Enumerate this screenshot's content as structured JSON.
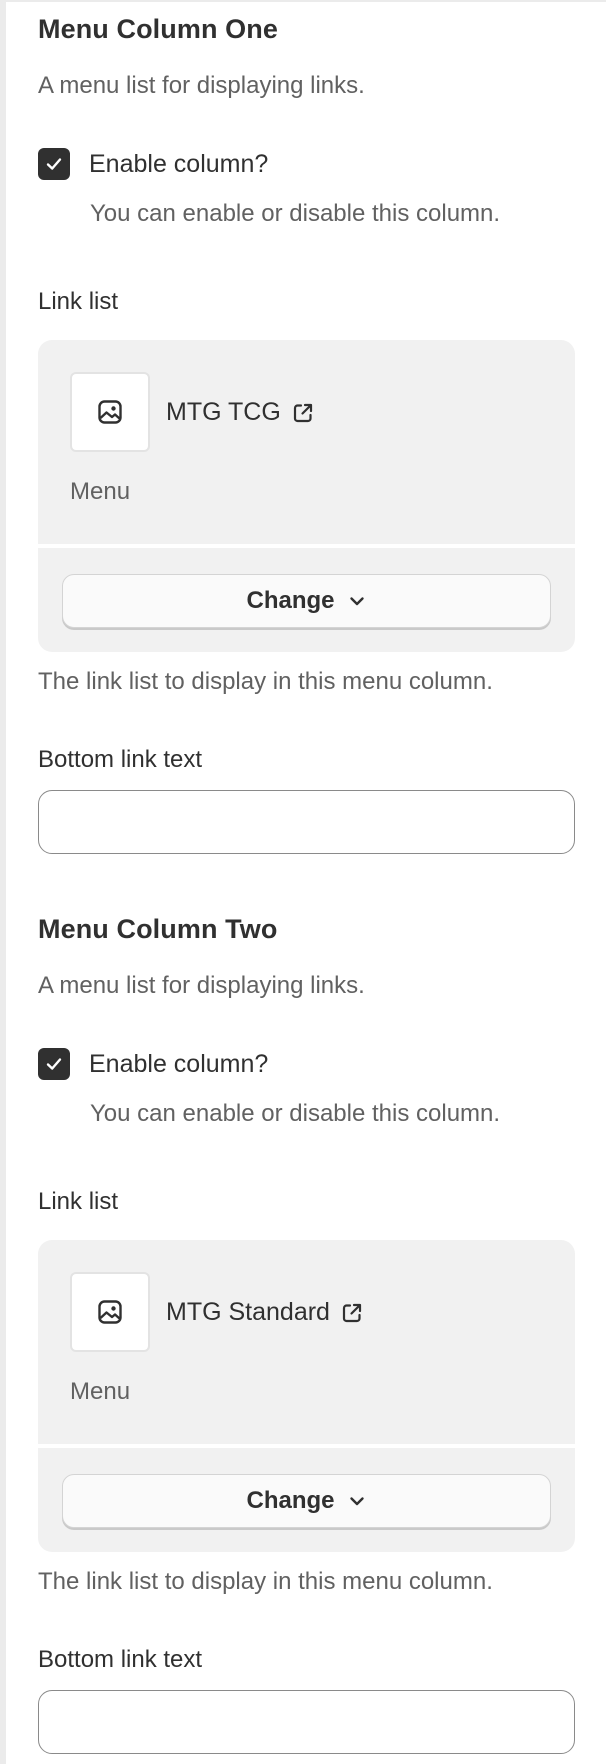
{
  "sections": [
    {
      "title": "Menu Column One",
      "description": "A menu list for displaying links.",
      "enable_label": "Enable column?",
      "enable_help": "You can enable or disable this column.",
      "enabled": true,
      "link_list_label": "Link list",
      "link": {
        "title": "MTG TCG",
        "type": "Menu"
      },
      "change_label": "Change",
      "link_list_help": "The link list to display in this menu column.",
      "bottom_label": "Bottom link text",
      "bottom_value": ""
    },
    {
      "title": "Menu Column Two",
      "description": "A menu list for displaying links.",
      "enable_label": "Enable column?",
      "enable_help": "You can enable or disable this column.",
      "enabled": true,
      "link_list_label": "Link list",
      "link": {
        "title": "MTG Standard",
        "type": "Menu"
      },
      "change_label": "Change",
      "link_list_help": "The link list to display in this menu column.",
      "bottom_label": "Bottom link text",
      "bottom_value": ""
    }
  ],
  "icons": {
    "checkbox": "check-icon",
    "thumbnail": "image-icon",
    "external": "external-link-icon",
    "dropdown": "chevron-down-icon"
  },
  "colors": {
    "text": "#303030",
    "muted": "#616161",
    "card_bg": "#f1f1f1",
    "checkbox_bg": "#303030"
  }
}
